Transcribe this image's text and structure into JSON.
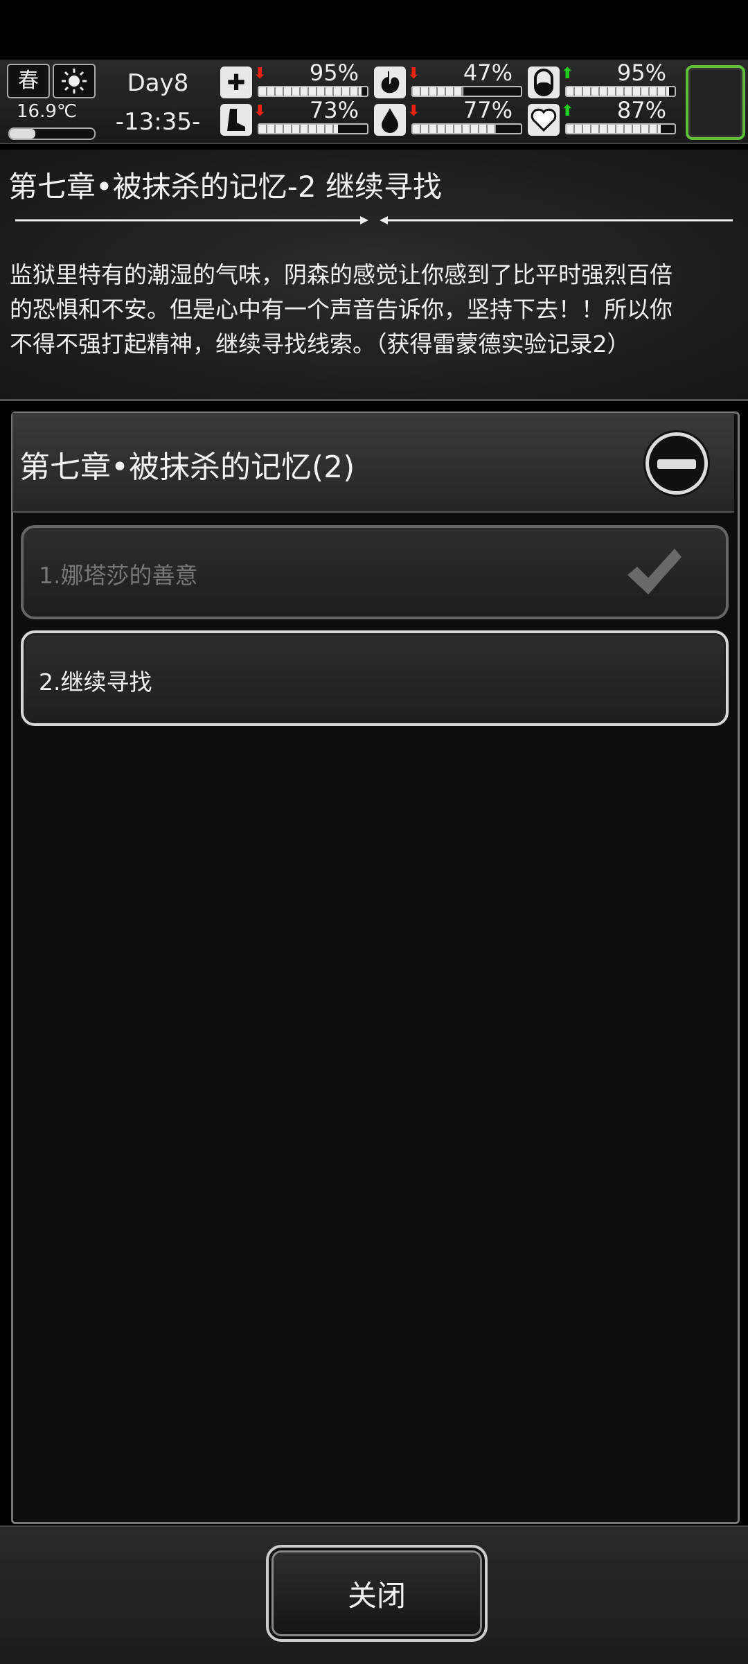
{
  "status": {
    "season": "春",
    "weather_icon": "sun-icon",
    "temperature": "16.9℃",
    "temperature_level": 0.3,
    "day": "Day8",
    "time": "-13:35-",
    "stats": [
      {
        "icon": "first-aid-icon",
        "trend": "down",
        "value": "95%",
        "level": 0.95
      },
      {
        "icon": "stomach-icon",
        "trend": "down",
        "value": "47%",
        "level": 0.47
      },
      {
        "icon": "pill-icon",
        "trend": "up",
        "value": "95%",
        "level": 0.95
      },
      {
        "icon": "boot-icon",
        "trend": "down",
        "value": "73%",
        "level": 0.73
      },
      {
        "icon": "water-drop-icon",
        "trend": "down",
        "value": "77%",
        "level": 0.77
      },
      {
        "icon": "heart-icon",
        "trend": "up",
        "value": "87%",
        "level": 0.87
      }
    ],
    "accent_color": "#5fbf3a"
  },
  "story": {
    "title": "第七章•被抹杀的记忆-2 继续寻找",
    "lines": [
      "监狱里特有的潮湿的气味，阴森的感觉让你感到了比平时强烈百倍",
      "的恐惧和不安。但是心中有一个声音告诉你，坚持下去！！所以你",
      "不得不强打起精神，继续寻找线索。（获得雷蒙德实验记录2）"
    ]
  },
  "quest": {
    "chapter": "第七章•被抹杀的记忆(2)",
    "items": [
      {
        "label": "1.娜塔莎的善意",
        "status": "done"
      },
      {
        "label": "2.继续寻找",
        "status": "active"
      }
    ]
  },
  "footer": {
    "close_label": "关闭"
  }
}
